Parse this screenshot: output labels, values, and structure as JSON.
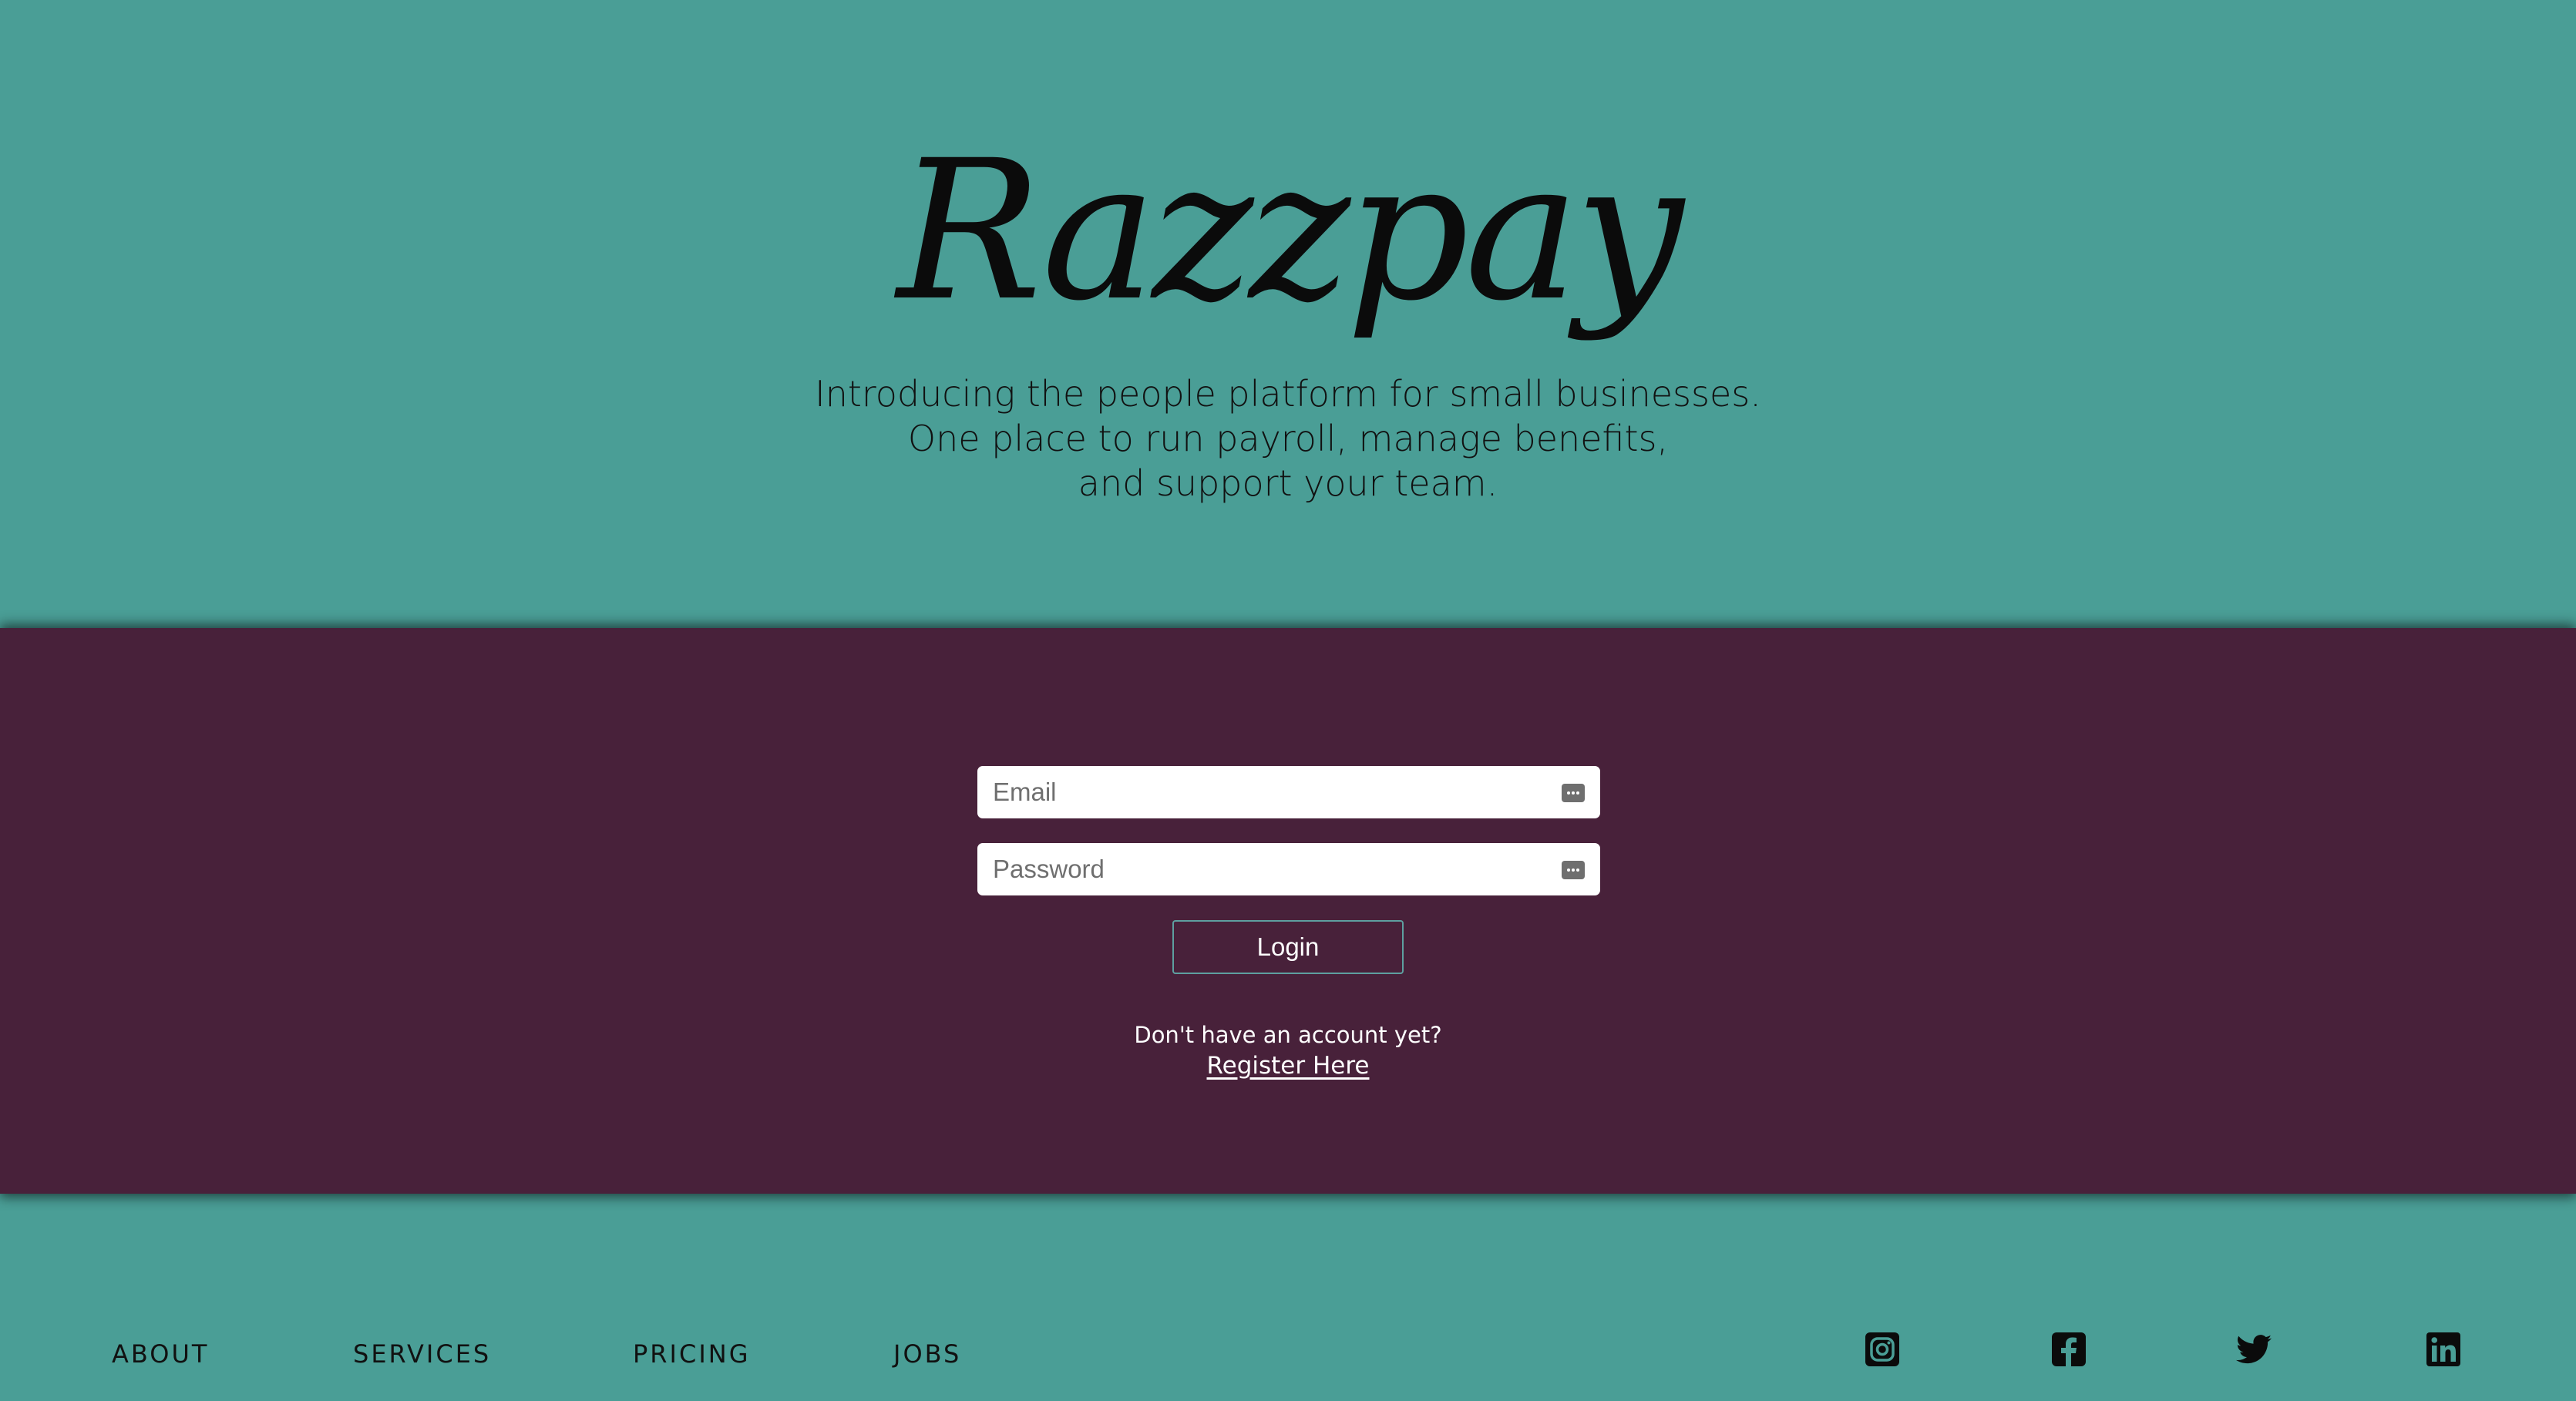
{
  "hero": {
    "logo": "Razzpay",
    "tagline": [
      "Introducing the people platform for small businesses.",
      "One place to run payroll, manage benefits,",
      "and support your team."
    ]
  },
  "login": {
    "email_placeholder": "Email",
    "password_placeholder": "Password",
    "login_label": "Login",
    "no_account_text": "Don't have an account yet?",
    "register_link": "Register Here"
  },
  "footer": {
    "nav": [
      "ABOUT",
      "SERVICES",
      "PRICING",
      "JOBS"
    ],
    "social_icons": [
      "instagram-icon",
      "facebook-icon",
      "twitter-icon",
      "linkedin-icon"
    ]
  },
  "colors": {
    "hero_bg": "#4a9e96",
    "band_bg": "#48213a",
    "login_border": "#5e9fa0"
  }
}
